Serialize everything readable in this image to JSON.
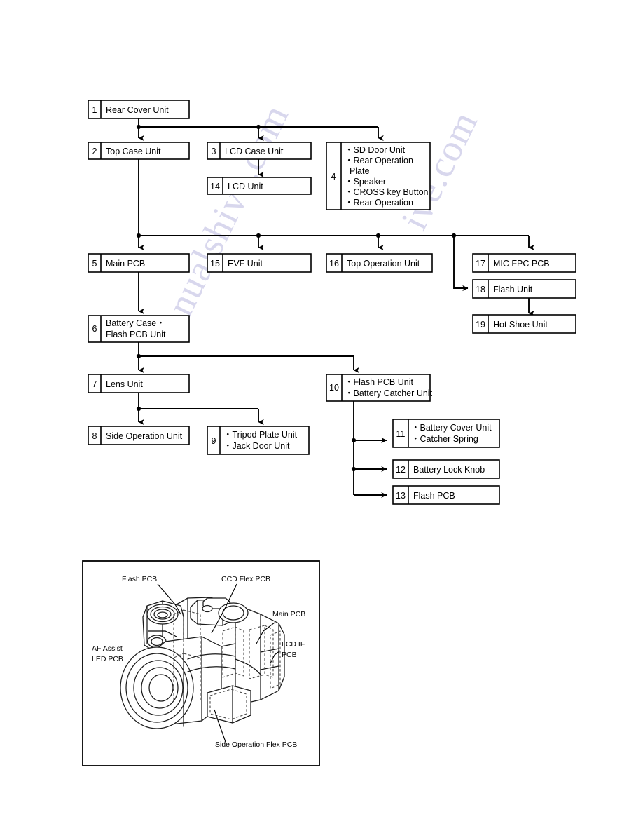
{
  "document": {
    "type": "disassembly-flow-chart",
    "watermark_left": "anualshive.com",
    "watermark_right": "ive.com"
  },
  "flowchart": {
    "boxes": [
      {
        "id": "b1",
        "num": "1",
        "lines": [
          "Rear Cover Unit"
        ]
      },
      {
        "id": "b2",
        "num": "2",
        "lines": [
          "Top Case Unit"
        ]
      },
      {
        "id": "b3",
        "num": "3",
        "lines": [
          "LCD Case Unit"
        ]
      },
      {
        "id": "b14",
        "num": "14",
        "lines": [
          "LCD Unit"
        ]
      },
      {
        "id": "b4",
        "num": "4",
        "lines": [
          "・SD Door Unit",
          "・Rear Operation",
          "  Plate",
          "・Speaker",
          "・CROSS key Button",
          "・Rear Operation"
        ]
      },
      {
        "id": "b5",
        "num": "5",
        "lines": [
          "Main PCB"
        ]
      },
      {
        "id": "b15",
        "num": "15",
        "lines": [
          "EVF Unit"
        ]
      },
      {
        "id": "b16",
        "num": "16",
        "lines": [
          "Top Operation Unit"
        ]
      },
      {
        "id": "b17",
        "num": "17",
        "lines": [
          "MIC FPC PCB"
        ]
      },
      {
        "id": "b18",
        "num": "18",
        "lines": [
          "Flash Unit"
        ]
      },
      {
        "id": "b19",
        "num": "19",
        "lines": [
          "Hot Shoe Unit"
        ]
      },
      {
        "id": "b6",
        "num": "6",
        "lines": [
          "Battery Case・",
          "Flash PCB Unit"
        ]
      },
      {
        "id": "b7",
        "num": "7",
        "lines": [
          "Lens Unit"
        ]
      },
      {
        "id": "b8",
        "num": "8",
        "lines": [
          "Side Operation Unit"
        ]
      },
      {
        "id": "b9",
        "num": "9",
        "lines": [
          "・Tripod Plate Unit",
          "・Jack Door Unit"
        ]
      },
      {
        "id": "b10",
        "num": "10",
        "lines": [
          "・Flash PCB Unit",
          "・Battery Catcher Unit"
        ]
      },
      {
        "id": "b11",
        "num": "11",
        "lines": [
          "・Battery Cover Unit",
          "・Catcher Spring"
        ]
      },
      {
        "id": "b12",
        "num": "12",
        "lines": [
          "Battery Lock Knob"
        ]
      },
      {
        "id": "b13",
        "num": "13",
        "lines": [
          "Flash PCB"
        ]
      }
    ]
  },
  "illustration": {
    "title": "camera-exploded-view",
    "callouts": [
      {
        "id": "c1",
        "text": "Flash PCB"
      },
      {
        "id": "c2",
        "text": "CCD Flex PCB"
      },
      {
        "id": "c3",
        "text": "Main PCB"
      },
      {
        "id": "c4",
        "text": "LCD IF"
      },
      {
        "id": "c5",
        "text": "PCB"
      },
      {
        "id": "c6",
        "text": "AF Assist"
      },
      {
        "id": "c7",
        "text": "LED PCB"
      },
      {
        "id": "c8",
        "text": "Side Operation Flex PCB"
      }
    ]
  }
}
